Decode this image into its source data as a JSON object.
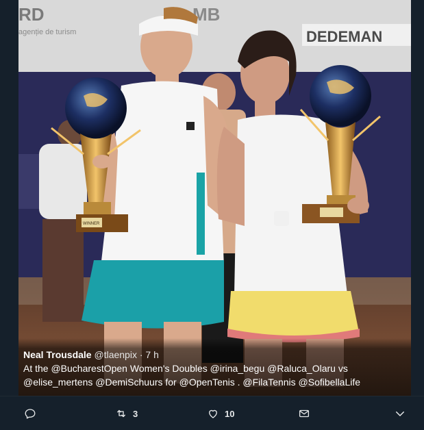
{
  "tweet": {
    "author_name": "Neal Trousdale",
    "handle": "@tlaenpix",
    "separator": " · ",
    "time": "7 h",
    "line1": "At the @BucharestOpen Women's Doubles @irina_begu @Raluca_Olaru vs",
    "line2": "@elise_mertens @DemiSchuurs for @OpenTenis . @FilaTennis @SofibellaLife"
  },
  "photo": {
    "banner_left_text": "RD",
    "banner_small_text": "agenție de turism",
    "banner_mid_text": "MB",
    "banner_right_text": "DEDEMAN",
    "trophy_plate": "WINNER"
  },
  "actions": {
    "reply_icon": "reply-icon",
    "retweet_icon": "retweet-icon",
    "retweet_count": "3",
    "like_icon": "heart-icon",
    "like_count": "10",
    "message_icon": "envelope-icon",
    "more_icon": "chevron-down-icon"
  },
  "colors": {
    "background": "#15202b",
    "text": "#ffffff",
    "icon": "#e7e9ea"
  }
}
